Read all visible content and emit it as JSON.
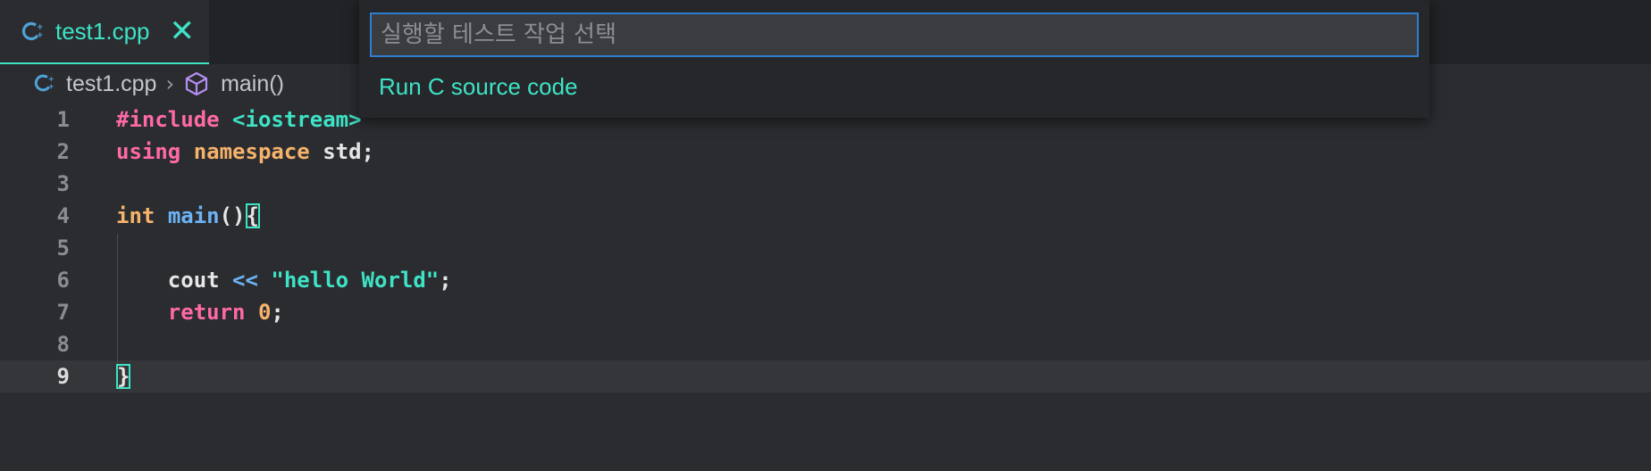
{
  "tab": {
    "label": "test1.cpp",
    "close_glyph": "✕",
    "icon": "cpp-file-icon"
  },
  "breadcrumb": {
    "file": "test1.cpp",
    "separator": "›",
    "symbol_icon": "cube-icon",
    "symbol": "main()"
  },
  "editor": {
    "current_line": 9,
    "lines": [
      {
        "n": "1",
        "tokens": [
          {
            "t": "#include",
            "c": "pink"
          },
          {
            "t": " ",
            "c": "white"
          },
          {
            "t": "<iostream>",
            "c": "teal"
          }
        ]
      },
      {
        "n": "2",
        "tokens": [
          {
            "t": "using",
            "c": "pink"
          },
          {
            "t": " ",
            "c": "white"
          },
          {
            "t": "namespace",
            "c": "orange"
          },
          {
            "t": " std;",
            "c": "white"
          }
        ]
      },
      {
        "n": "3",
        "tokens": []
      },
      {
        "n": "4",
        "tokens": [
          {
            "t": "int",
            "c": "orange"
          },
          {
            "t": " ",
            "c": "white"
          },
          {
            "t": "main",
            "c": "blue"
          },
          {
            "t": "()",
            "c": "white"
          },
          {
            "t": "{",
            "c": "white",
            "box": true
          }
        ]
      },
      {
        "n": "5",
        "tokens": []
      },
      {
        "n": "6",
        "tokens": [
          {
            "t": "    cout ",
            "c": "white"
          },
          {
            "t": "<<",
            "c": "blue"
          },
          {
            "t": " ",
            "c": "white"
          },
          {
            "t": "\"hello World\"",
            "c": "teal"
          },
          {
            "t": ";",
            "c": "white"
          }
        ]
      },
      {
        "n": "7",
        "tokens": [
          {
            "t": "    ",
            "c": "white"
          },
          {
            "t": "return",
            "c": "pink"
          },
          {
            "t": " ",
            "c": "white"
          },
          {
            "t": "0",
            "c": "orange"
          },
          {
            "t": ";",
            "c": "white"
          }
        ]
      },
      {
        "n": "8",
        "tokens": []
      },
      {
        "n": "9",
        "tokens": [
          {
            "t": "}",
            "c": "white",
            "box": true
          }
        ]
      }
    ]
  },
  "quickpick": {
    "placeholder": "실행할 테스트 작업 선택",
    "items": [
      "Run C source code"
    ]
  },
  "colors": {
    "accent": "#3ee3c6",
    "focus_border": "#2e7fd0",
    "background": "#2b2c30"
  }
}
